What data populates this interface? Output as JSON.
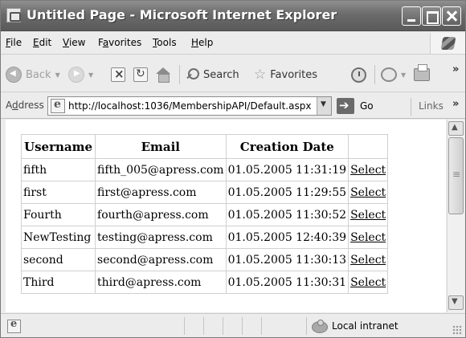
{
  "window": {
    "title": "Untitled Page - Microsoft Internet Explorer"
  },
  "menubar": {
    "file": "File",
    "edit": "Edit",
    "view": "View",
    "favorites": "Favorites",
    "tools": "Tools",
    "help": "Help"
  },
  "toolbar": {
    "back": "Back",
    "search": "Search",
    "favorites": "Favorites",
    "overflow": "»"
  },
  "address": {
    "label": "Address",
    "url": "http://localhost:1036/MembershipAPI/Default.aspx",
    "go": "Go",
    "links": "Links",
    "overflow": "»"
  },
  "table": {
    "headers": [
      "Username",
      "Email",
      "Creation Date",
      ""
    ],
    "rows": [
      {
        "username": "fifth",
        "email": "fifth_005@apress.com",
        "created": "01.05.2005 11:31:19",
        "action": "Select"
      },
      {
        "username": "first",
        "email": "first@apress.com",
        "created": "01.05.2005 11:29:55",
        "action": "Select"
      },
      {
        "username": "Fourth",
        "email": "fourth@apress.com",
        "created": "01.05.2005 11:30:52",
        "action": "Select"
      },
      {
        "username": "NewTesting",
        "email": "testing@apress.com",
        "created": "01.05.2005 12:40:39",
        "action": "Select"
      },
      {
        "username": "second",
        "email": "second@apress.com",
        "created": "01.05.2005 11:30:13",
        "action": "Select"
      },
      {
        "username": "Third",
        "email": "third@apress.com",
        "created": "01.05.2005 11:30:31",
        "action": "Select"
      }
    ]
  },
  "status": {
    "zone": "Local intranet"
  },
  "icons": {
    "app": "ie-page-icon",
    "back": "back-arrow-icon",
    "forward": "forward-arrow-icon",
    "stop": "stop-icon",
    "refresh": "refresh-icon",
    "home": "home-icon",
    "search": "search-icon",
    "favorites": "star-icon",
    "history": "history-icon",
    "mail": "mail-icon",
    "print": "print-icon",
    "go": "go-arrow-icon",
    "zone": "intranet-icon"
  }
}
